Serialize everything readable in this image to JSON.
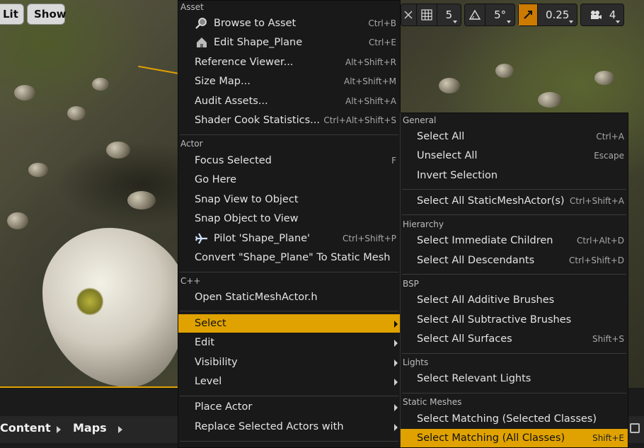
{
  "viewport": {
    "buttons": {
      "lit": "Lit",
      "show": "Show"
    },
    "toolbar": {
      "grid_value": "5",
      "angle_value": "5°",
      "scale_value": "0.25",
      "camera_value": "4"
    }
  },
  "breadcrumb": {
    "content": "Content",
    "maps": "Maps"
  },
  "context_menu": {
    "sections": {
      "asset": "Asset",
      "actor": "Actor",
      "cpp": "C++"
    },
    "items": {
      "browse_to_asset": {
        "label": "Browse to Asset",
        "shortcut": "Ctrl+B"
      },
      "edit_shape_plane": {
        "label": "Edit Shape_Plane",
        "shortcut": "Ctrl+E"
      },
      "reference_viewer": {
        "label": "Reference Viewer...",
        "shortcut": "Alt+Shift+R"
      },
      "size_map": {
        "label": "Size Map...",
        "shortcut": "Alt+Shift+M"
      },
      "audit_assets": {
        "label": "Audit Assets...",
        "shortcut": "Alt+Shift+A"
      },
      "shader_cook": {
        "label": "Shader Cook Statistics...",
        "shortcut": "Ctrl+Alt+Shift+S"
      },
      "focus_selected": {
        "label": "Focus Selected",
        "shortcut": "F"
      },
      "go_here": {
        "label": "Go Here"
      },
      "snap_view": {
        "label": "Snap View to Object"
      },
      "snap_object": {
        "label": "Snap Object to View"
      },
      "pilot": {
        "label": "Pilot 'Shape_Plane'",
        "shortcut": "Ctrl+Shift+P"
      },
      "convert": {
        "label": "Convert \"Shape_Plane\" To Static Mesh"
      },
      "open_header": {
        "label": "Open StaticMeshActor.h"
      },
      "select": {
        "label": "Select"
      },
      "edit": {
        "label": "Edit"
      },
      "visibility": {
        "label": "Visibility"
      },
      "level": {
        "label": "Level"
      },
      "place_actor": {
        "label": "Place Actor"
      },
      "replace_actors": {
        "label": "Replace Selected Actors with"
      }
    }
  },
  "select_submenu": {
    "sections": {
      "general": "General",
      "hierarchy": "Hierarchy",
      "bsp": "BSP",
      "lights": "Lights",
      "static_meshes": "Static Meshes"
    },
    "items": {
      "select_all": {
        "label": "Select All",
        "shortcut": "Ctrl+A"
      },
      "unselect_all": {
        "label": "Unselect All",
        "shortcut": "Escape"
      },
      "invert": {
        "label": "Invert Selection"
      },
      "select_all_sma": {
        "label": "Select All StaticMeshActor(s)",
        "shortcut": "Ctrl+Shift+A"
      },
      "immediate_children": {
        "label": "Select Immediate Children",
        "shortcut": "Ctrl+Alt+D"
      },
      "all_descendants": {
        "label": "Select All Descendants",
        "shortcut": "Ctrl+Shift+D"
      },
      "additive_brushes": {
        "label": "Select All Additive Brushes"
      },
      "subtractive_brushes": {
        "label": "Select All Subtractive Brushes"
      },
      "all_surfaces": {
        "label": "Select All Surfaces",
        "shortcut": "Shift+S"
      },
      "relevant_lights": {
        "label": "Select Relevant Lights"
      },
      "matching_selected": {
        "label": "Select Matching (Selected Classes)"
      },
      "matching_all": {
        "label": "Select Matching (All Classes)",
        "shortcut": "Shift+E"
      }
    }
  },
  "colors": {
    "highlight": "#e0a200",
    "menu_bg": "#191919",
    "active_tool": "#cc7a00"
  }
}
